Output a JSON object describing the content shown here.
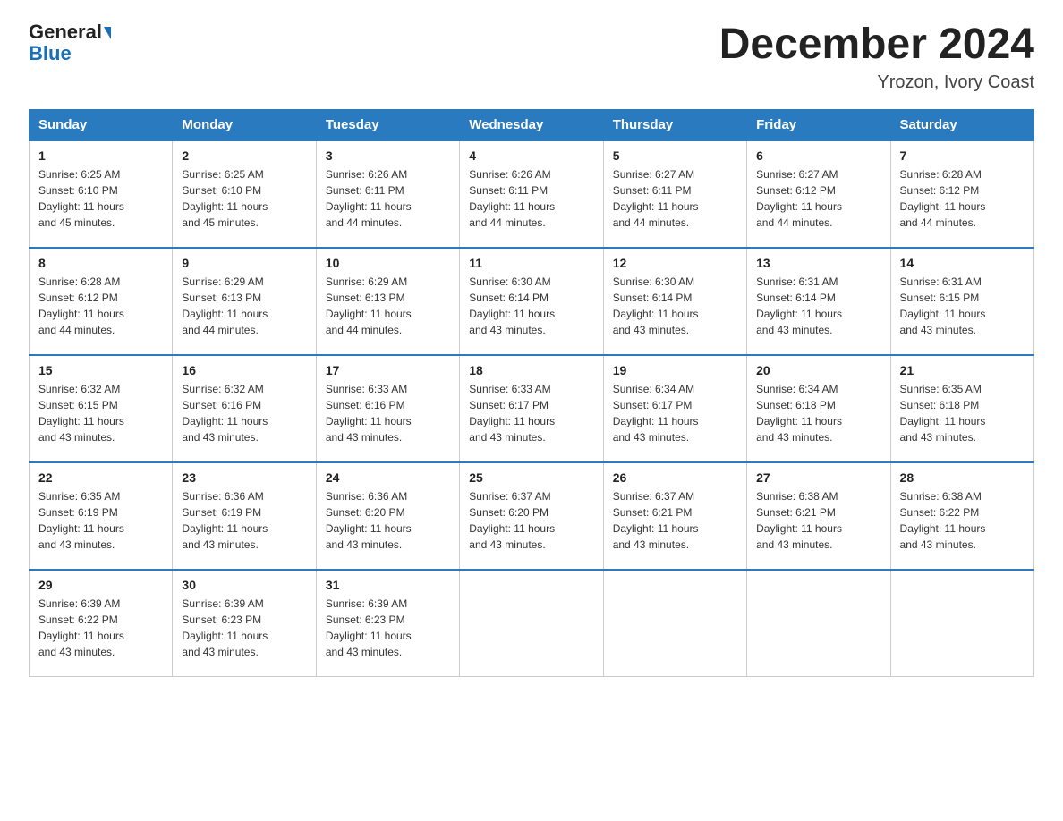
{
  "logo": {
    "line1": "General",
    "line2": "Blue"
  },
  "title": "December 2024",
  "subtitle": "Yrozon, Ivory Coast",
  "days_of_week": [
    "Sunday",
    "Monday",
    "Tuesday",
    "Wednesday",
    "Thursday",
    "Friday",
    "Saturday"
  ],
  "weeks": [
    [
      {
        "day": "1",
        "sunrise": "6:25 AM",
        "sunset": "6:10 PM",
        "daylight": "11 hours and 45 minutes."
      },
      {
        "day": "2",
        "sunrise": "6:25 AM",
        "sunset": "6:10 PM",
        "daylight": "11 hours and 45 minutes."
      },
      {
        "day": "3",
        "sunrise": "6:26 AM",
        "sunset": "6:11 PM",
        "daylight": "11 hours and 44 minutes."
      },
      {
        "day": "4",
        "sunrise": "6:26 AM",
        "sunset": "6:11 PM",
        "daylight": "11 hours and 44 minutes."
      },
      {
        "day": "5",
        "sunrise": "6:27 AM",
        "sunset": "6:11 PM",
        "daylight": "11 hours and 44 minutes."
      },
      {
        "day": "6",
        "sunrise": "6:27 AM",
        "sunset": "6:12 PM",
        "daylight": "11 hours and 44 minutes."
      },
      {
        "day": "7",
        "sunrise": "6:28 AM",
        "sunset": "6:12 PM",
        "daylight": "11 hours and 44 minutes."
      }
    ],
    [
      {
        "day": "8",
        "sunrise": "6:28 AM",
        "sunset": "6:12 PM",
        "daylight": "11 hours and 44 minutes."
      },
      {
        "day": "9",
        "sunrise": "6:29 AM",
        "sunset": "6:13 PM",
        "daylight": "11 hours and 44 minutes."
      },
      {
        "day": "10",
        "sunrise": "6:29 AM",
        "sunset": "6:13 PM",
        "daylight": "11 hours and 44 minutes."
      },
      {
        "day": "11",
        "sunrise": "6:30 AM",
        "sunset": "6:14 PM",
        "daylight": "11 hours and 43 minutes."
      },
      {
        "day": "12",
        "sunrise": "6:30 AM",
        "sunset": "6:14 PM",
        "daylight": "11 hours and 43 minutes."
      },
      {
        "day": "13",
        "sunrise": "6:31 AM",
        "sunset": "6:14 PM",
        "daylight": "11 hours and 43 minutes."
      },
      {
        "day": "14",
        "sunrise": "6:31 AM",
        "sunset": "6:15 PM",
        "daylight": "11 hours and 43 minutes."
      }
    ],
    [
      {
        "day": "15",
        "sunrise": "6:32 AM",
        "sunset": "6:15 PM",
        "daylight": "11 hours and 43 minutes."
      },
      {
        "day": "16",
        "sunrise": "6:32 AM",
        "sunset": "6:16 PM",
        "daylight": "11 hours and 43 minutes."
      },
      {
        "day": "17",
        "sunrise": "6:33 AM",
        "sunset": "6:16 PM",
        "daylight": "11 hours and 43 minutes."
      },
      {
        "day": "18",
        "sunrise": "6:33 AM",
        "sunset": "6:17 PM",
        "daylight": "11 hours and 43 minutes."
      },
      {
        "day": "19",
        "sunrise": "6:34 AM",
        "sunset": "6:17 PM",
        "daylight": "11 hours and 43 minutes."
      },
      {
        "day": "20",
        "sunrise": "6:34 AM",
        "sunset": "6:18 PM",
        "daylight": "11 hours and 43 minutes."
      },
      {
        "day": "21",
        "sunrise": "6:35 AM",
        "sunset": "6:18 PM",
        "daylight": "11 hours and 43 minutes."
      }
    ],
    [
      {
        "day": "22",
        "sunrise": "6:35 AM",
        "sunset": "6:19 PM",
        "daylight": "11 hours and 43 minutes."
      },
      {
        "day": "23",
        "sunrise": "6:36 AM",
        "sunset": "6:19 PM",
        "daylight": "11 hours and 43 minutes."
      },
      {
        "day": "24",
        "sunrise": "6:36 AM",
        "sunset": "6:20 PM",
        "daylight": "11 hours and 43 minutes."
      },
      {
        "day": "25",
        "sunrise": "6:37 AM",
        "sunset": "6:20 PM",
        "daylight": "11 hours and 43 minutes."
      },
      {
        "day": "26",
        "sunrise": "6:37 AM",
        "sunset": "6:21 PM",
        "daylight": "11 hours and 43 minutes."
      },
      {
        "day": "27",
        "sunrise": "6:38 AM",
        "sunset": "6:21 PM",
        "daylight": "11 hours and 43 minutes."
      },
      {
        "day": "28",
        "sunrise": "6:38 AM",
        "sunset": "6:22 PM",
        "daylight": "11 hours and 43 minutes."
      }
    ],
    [
      {
        "day": "29",
        "sunrise": "6:39 AM",
        "sunset": "6:22 PM",
        "daylight": "11 hours and 43 minutes."
      },
      {
        "day": "30",
        "sunrise": "6:39 AM",
        "sunset": "6:23 PM",
        "daylight": "11 hours and 43 minutes."
      },
      {
        "day": "31",
        "sunrise": "6:39 AM",
        "sunset": "6:23 PM",
        "daylight": "11 hours and 43 minutes."
      },
      null,
      null,
      null,
      null
    ]
  ],
  "labels": {
    "sunrise": "Sunrise:",
    "sunset": "Sunset:",
    "daylight": "Daylight:"
  },
  "colors": {
    "header_bg": "#2a7abf",
    "header_text": "#ffffff",
    "border": "#2a7abf"
  }
}
